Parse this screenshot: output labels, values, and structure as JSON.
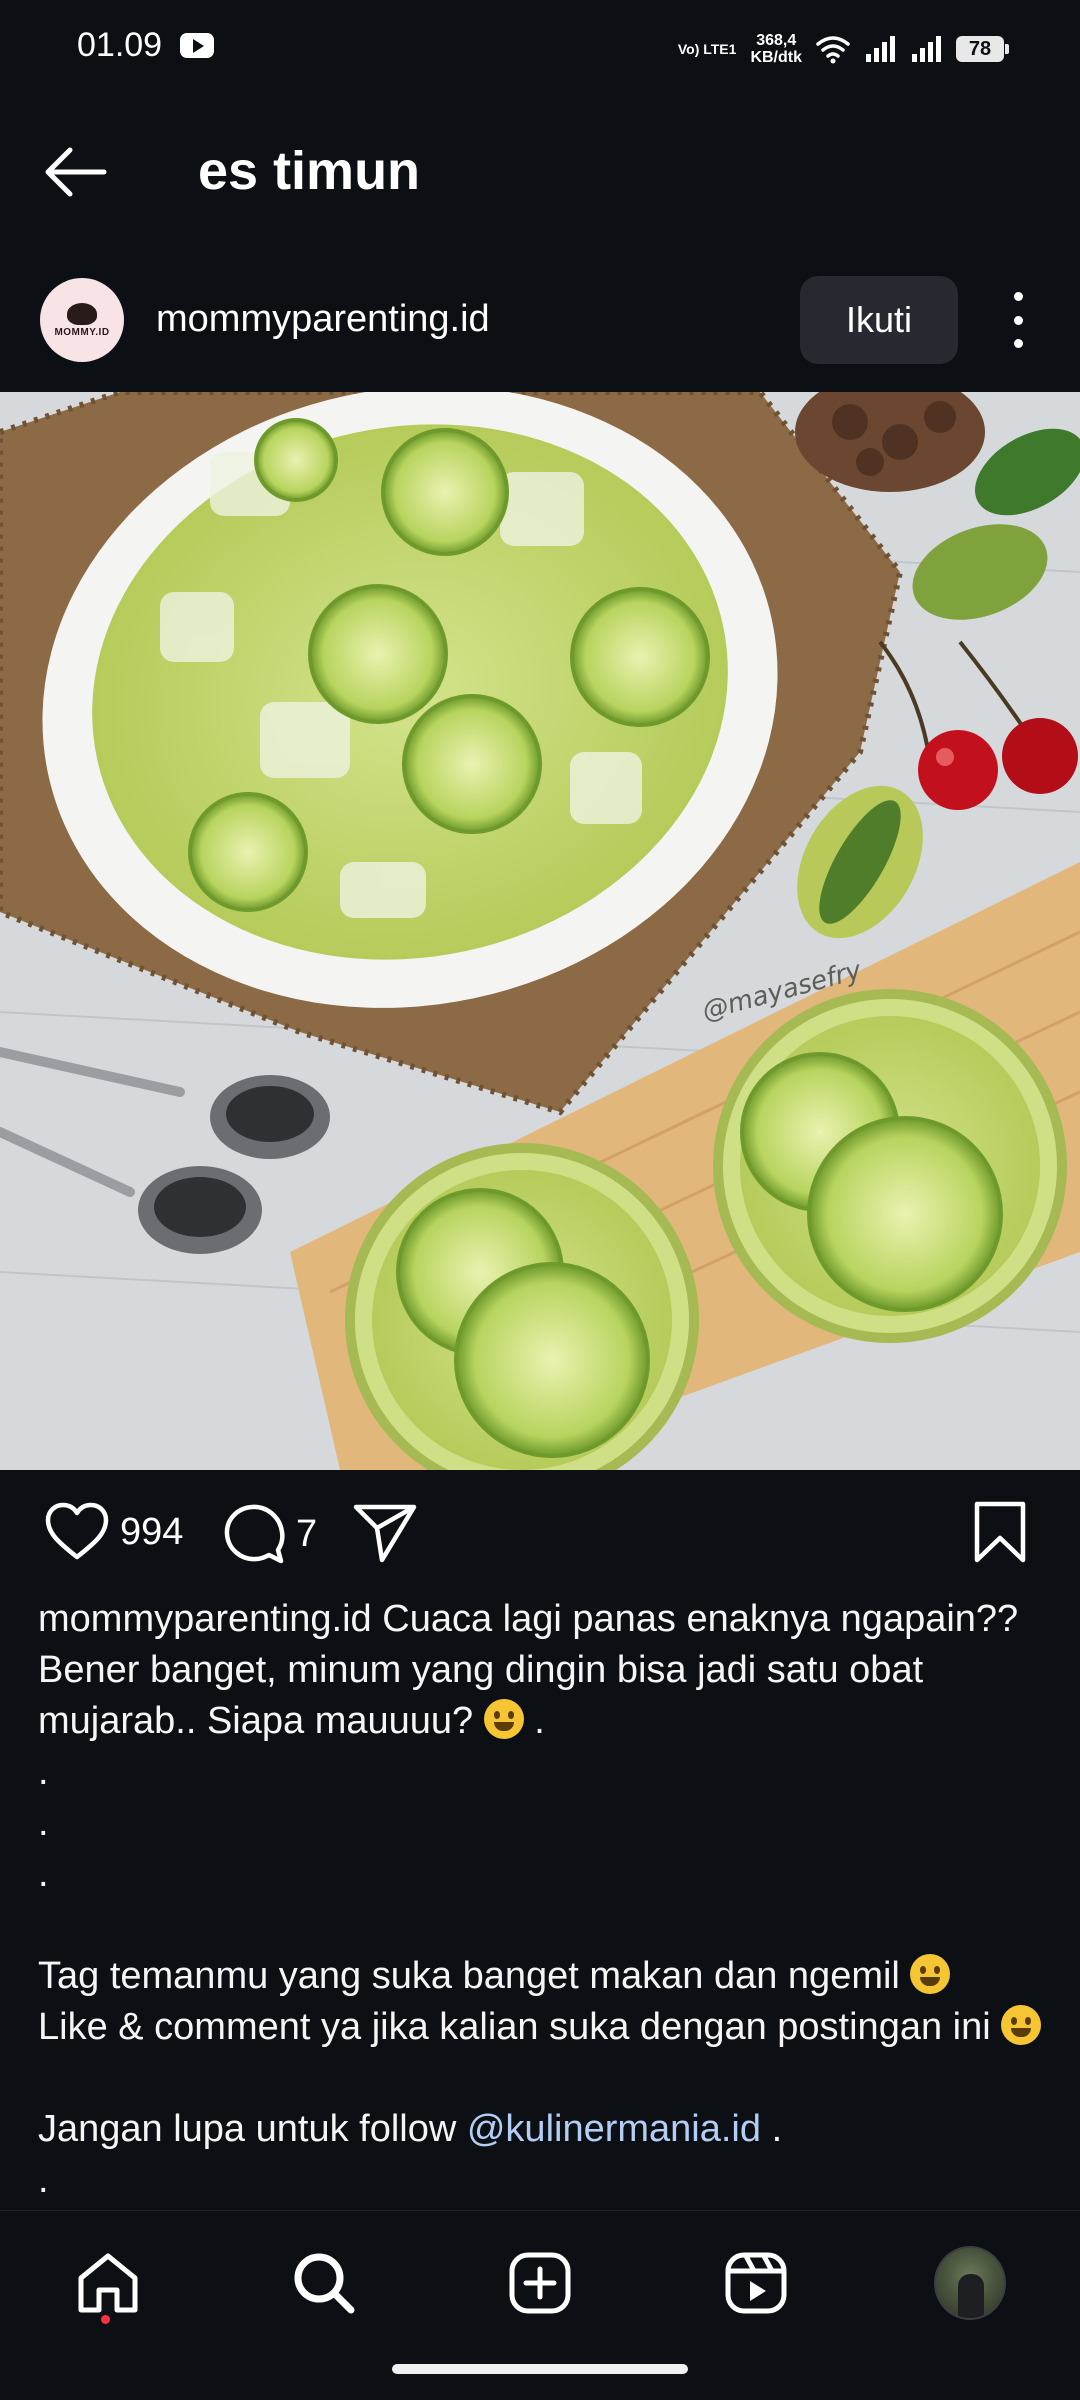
{
  "status_bar": {
    "time": "01.09",
    "network_label": "Vo) LTE1",
    "speed_value": "368,4",
    "speed_unit": "KB/dtk",
    "battery": "78"
  },
  "header": {
    "title": "es timun"
  },
  "post": {
    "username": "mommyparenting.id",
    "avatar_text": "MOMMY.ID",
    "follow_label": "Ikuti",
    "image_watermark": "@mayasefry",
    "likes": "994",
    "comments": "7",
    "caption": {
      "line1": " Cuaca lagi panas enaknya ngapain??",
      "line2": "Bener banget, minum yang dingin bisa jadi satu obat",
      "line3a": "mujarab.. Siapa mauuuu? ",
      "line3b": " .",
      "dot": ".",
      "tag_line": "Tag temanmu yang suka banget makan dan ngemil ",
      "like_line": "Like & comment ya jika kalian suka dengan postingan ini ",
      "follow_line": "Jangan lupa untuk follow ",
      "mention": "@kulinermania.id",
      "follow_end": " ."
    }
  },
  "nav": {
    "items": [
      "home",
      "search",
      "create",
      "reels",
      "profile"
    ]
  },
  "colors": {
    "background": "#0c1014",
    "follow_button": "#262a30",
    "mention": "#b3cdf5",
    "notification_dot": "#ff3040"
  }
}
